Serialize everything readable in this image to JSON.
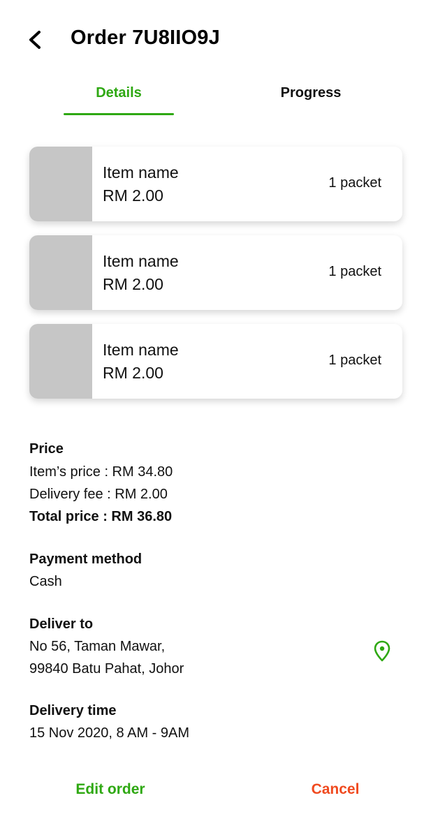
{
  "header": {
    "back_icon": "chevron-left-icon",
    "title": "Order 7U8IIO9J"
  },
  "tabs": [
    {
      "label": "Details",
      "active": true
    },
    {
      "label": "Progress",
      "active": false
    }
  ],
  "colors": {
    "accent": "#2ea812",
    "danger": "#f04a1f",
    "thumbnail_placeholder": "#c6c6c6"
  },
  "items": [
    {
      "name": "Item name",
      "price": "RM 2.00",
      "quantity": "1 packet"
    },
    {
      "name": "Item name",
      "price": "RM 2.00",
      "quantity": "1 packet"
    },
    {
      "name": "Item name",
      "price": "RM 2.00",
      "quantity": "1 packet"
    }
  ],
  "price": {
    "title": "Price",
    "items_price": "Item’s price : RM 34.80",
    "delivery_fee": "Delivery fee : RM 2.00",
    "total_price": "Total price : RM 36.80"
  },
  "payment": {
    "title": "Payment method",
    "value": "Cash"
  },
  "delivery": {
    "title": "Deliver to",
    "address_line1": "No 56, Taman Mawar,",
    "address_line2": "99840 Batu Pahat, Johor",
    "location_icon": "map-pin-icon"
  },
  "delivery_time": {
    "title": "Delivery time",
    "value": "15 Nov 2020, 8 AM - 9AM"
  },
  "actions": {
    "edit_label": "Edit order",
    "cancel_label": "Cancel"
  }
}
